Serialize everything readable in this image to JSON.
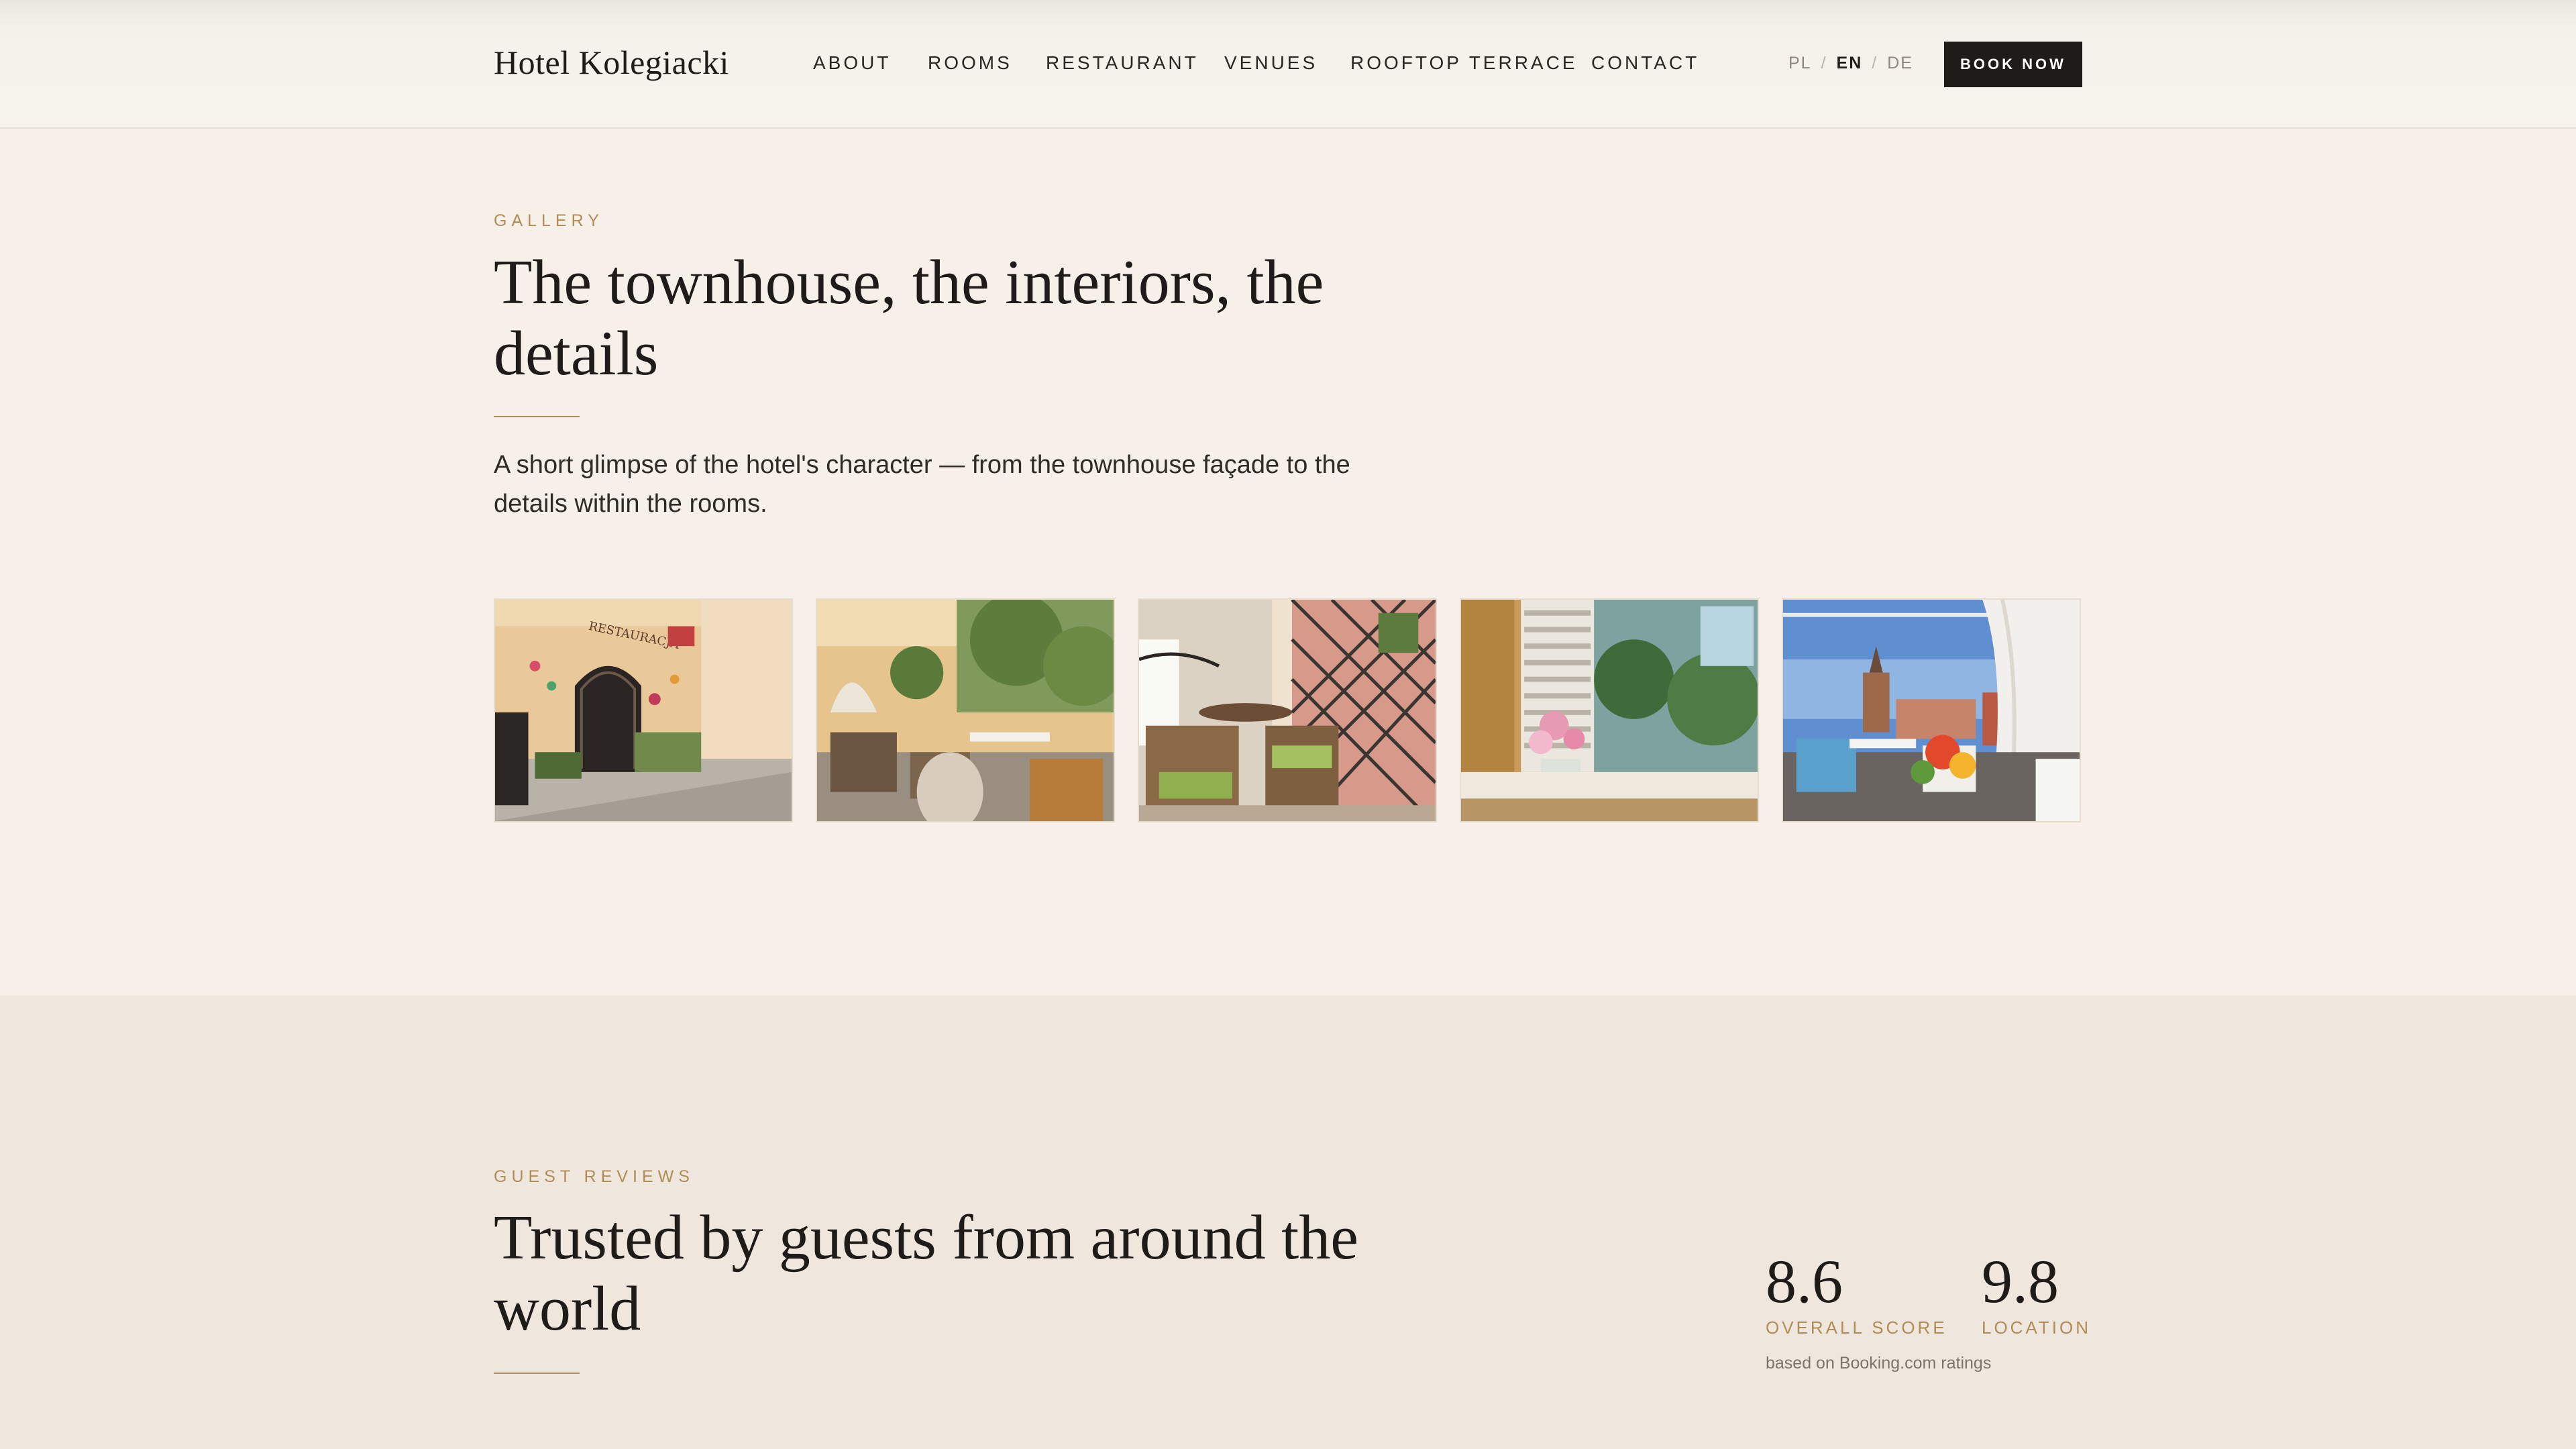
{
  "header": {
    "logo": "Hotel Kolegiacki",
    "nav": [
      "ABOUT",
      "ROOMS",
      "RESTAURANT",
      "VENUES",
      "ROOFTOP TERRACE",
      "CONTACT"
    ],
    "languages": [
      "PL",
      "EN",
      "DE"
    ],
    "active_language": "EN",
    "book_label": "BOOK NOW"
  },
  "gallery": {
    "eyebrow": "GALLERY",
    "title": "The townhouse, the interiors, the details",
    "description": "A short glimpse of the hotel's character — from the townhouse façade to the details within the rooms.",
    "images": [
      {
        "name": "townhouse-facade-photo"
      },
      {
        "name": "courtyard-restaurant-photo"
      },
      {
        "name": "balcony-seating-photo"
      },
      {
        "name": "window-flowers-photo"
      },
      {
        "name": "rooftop-terrace-photo"
      }
    ]
  },
  "reviews": {
    "eyebrow": "GUEST REVIEWS",
    "title": "Trusted by guests from around the world",
    "scores": [
      {
        "value": "8.6",
        "label": "OVERALL SCORE"
      },
      {
        "value": "9.8",
        "label": "LOCATION"
      }
    ],
    "note": "based on Booking.com ratings"
  },
  "colors": {
    "accent": "#b08d57",
    "background": "#f6f0e9",
    "reviews_background": "#efe7dd",
    "button": "#1f1b19"
  }
}
